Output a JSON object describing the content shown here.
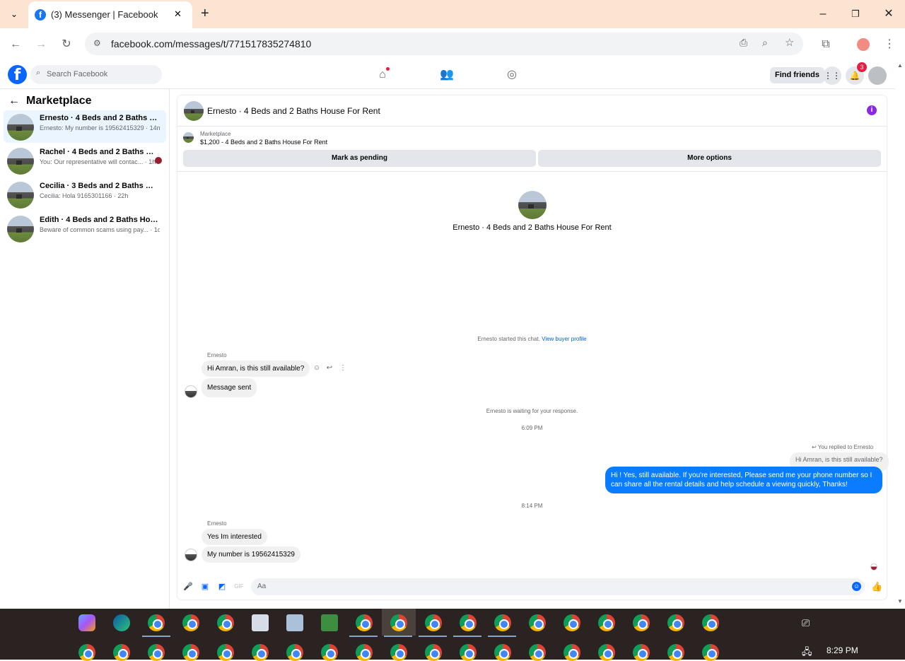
{
  "browser": {
    "tab_title": "(3) Messenger | Facebook",
    "url": "facebook.com/messages/t/771517835274810",
    "new_tab": "+",
    "close_tab": "✕",
    "minimize": "–",
    "restore": "❐",
    "close_window": "✕"
  },
  "fb_header": {
    "logo": "f",
    "search_placeholder": "Search Facebook",
    "find_friends": "Find friends",
    "notification_count": "3"
  },
  "sidebar": {
    "title": "Marketplace",
    "conversations": [
      {
        "name": "Ernesto · 4 Beds and 2 Baths House For Rent",
        "preview": "Ernesto: My number is 19562415329 · 14m"
      },
      {
        "name": "Rachel · 4 Beds and 2 Baths House For Rent",
        "preview": "You: Our representative will contac... · 1h"
      },
      {
        "name": "Cecilia · 3 Beds and 2 Baths House For Rent",
        "preview": "Cecilia: Hola 9165301166 · 22h"
      },
      {
        "name": "Edith · 4 Beds and 2 Baths House For Rent",
        "preview": "Beware of common scams using pay... · 1d"
      }
    ]
  },
  "chat": {
    "title": "Ernesto · 4 Beds and 2 Baths House For Rent",
    "listing_category": "Marketplace",
    "listing_price": "$1,200 - 4 Beds and 2 Baths House For Rent",
    "mark_pending": "Mark as pending",
    "more_options": "More options",
    "intro_title": "Ernesto · 4 Beds and 2 Baths House For Rent",
    "started_text": "Ernesto started this chat.",
    "view_profile": "View buyer profile",
    "sender1": "Ernesto",
    "msg1": "Hi Amran, is this still available?",
    "msg2": "Message sent",
    "waiting": "Ernesto is waiting for your response.",
    "time1": "6:09 PM",
    "replied_to": "You replied to Ernesto",
    "quoted": "Hi Amran, is this still available?",
    "my_msg": "Hi ! Yes, still available. If you're interested, Please send me your phone number so I can share all the rental details and help schedule a viewing quickly, Thanks!",
    "time2": "8:14 PM",
    "sender2": "Ernesto",
    "msg3": "Yes Im interested",
    "msg4": "My number is 19562415329",
    "composer_placeholder": "Aa"
  },
  "taskbar": {
    "time": "8:29 PM"
  }
}
